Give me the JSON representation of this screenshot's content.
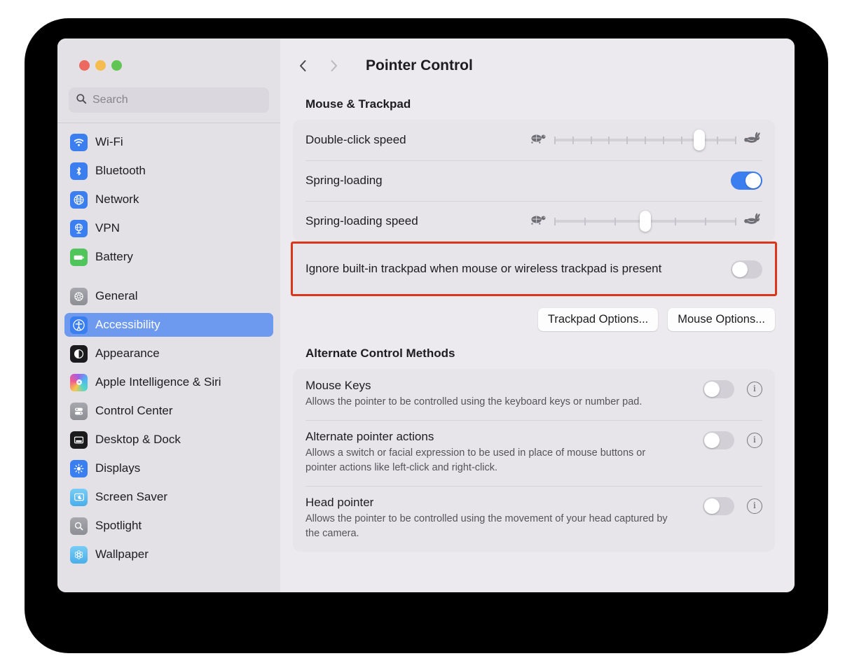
{
  "window": {
    "traffic_lights": [
      "close",
      "minimize",
      "zoom"
    ],
    "search_placeholder": "Search"
  },
  "sidebar": {
    "groups": [
      {
        "items": [
          {
            "label": "Wi-Fi",
            "icon": "wifi-icon",
            "selected": false
          },
          {
            "label": "Bluetooth",
            "icon": "bluetooth-icon",
            "selected": false
          },
          {
            "label": "Network",
            "icon": "globe-icon",
            "selected": false
          },
          {
            "label": "VPN",
            "icon": "vpn-icon",
            "selected": false
          },
          {
            "label": "Battery",
            "icon": "battery-icon",
            "selected": false
          }
        ]
      },
      {
        "items": [
          {
            "label": "General",
            "icon": "gear-icon",
            "selected": false
          },
          {
            "label": "Accessibility",
            "icon": "accessibility-icon",
            "selected": true
          },
          {
            "label": "Appearance",
            "icon": "appearance-icon",
            "selected": false
          },
          {
            "label": "Apple Intelligence & Siri",
            "icon": "siri-icon",
            "selected": false
          },
          {
            "label": "Control Center",
            "icon": "control-center-icon",
            "selected": false
          },
          {
            "label": "Desktop & Dock",
            "icon": "desktop-dock-icon",
            "selected": false
          },
          {
            "label": "Displays",
            "icon": "displays-icon",
            "selected": false
          },
          {
            "label": "Screen Saver",
            "icon": "screen-saver-icon",
            "selected": false
          },
          {
            "label": "Spotlight",
            "icon": "spotlight-icon",
            "selected": false
          },
          {
            "label": "Wallpaper",
            "icon": "wallpaper-icon",
            "selected": false
          }
        ]
      }
    ]
  },
  "header": {
    "back_icon": "chevron-left-icon",
    "forward_icon": "chevron-right-icon",
    "title": "Pointer Control"
  },
  "sections": {
    "mouse_trackpad": {
      "title": "Mouse & Trackpad",
      "double_click": {
        "label": "Double-click speed",
        "left_icon": "turtle-icon",
        "right_icon": "rabbit-icon",
        "ticks": 11,
        "value_index": 8
      },
      "spring_loading": {
        "label": "Spring-loading",
        "enabled": true
      },
      "spring_loading_speed": {
        "label": "Spring-loading speed",
        "left_icon": "turtle-icon",
        "right_icon": "rabbit-icon",
        "ticks": 7,
        "value_index": 3
      },
      "ignore_trackpad": {
        "label": "Ignore built-in trackpad when mouse or wireless trackpad is present",
        "enabled": false,
        "highlight_color": "#d9361a"
      },
      "buttons": {
        "trackpad_options": "Trackpad Options...",
        "mouse_options": "Mouse Options..."
      }
    },
    "alternate_control": {
      "title": "Alternate Control Methods",
      "rows": [
        {
          "label": "Mouse Keys",
          "desc": "Allows the pointer to be controlled using the keyboard keys or number pad.",
          "enabled": false,
          "info_icon": "info-icon"
        },
        {
          "label": "Alternate pointer actions",
          "desc": "Allows a switch or facial expression to be used in place of mouse buttons or pointer actions like left-click and right-click.",
          "enabled": false,
          "info_icon": "info-icon"
        },
        {
          "label": "Head pointer",
          "desc": "Allows the pointer to be controlled using the movement of your head captured by the camera.",
          "enabled": false,
          "info_icon": "info-icon"
        }
      ]
    }
  },
  "colors": {
    "accent_blue": "#3b7ef0",
    "selection_blue": "#6d99ef",
    "sidebar_bg": "#e3e1e6",
    "content_bg": "#eceaee",
    "card_bg": "#e7e5ea",
    "highlight_red": "#d9361a"
  }
}
